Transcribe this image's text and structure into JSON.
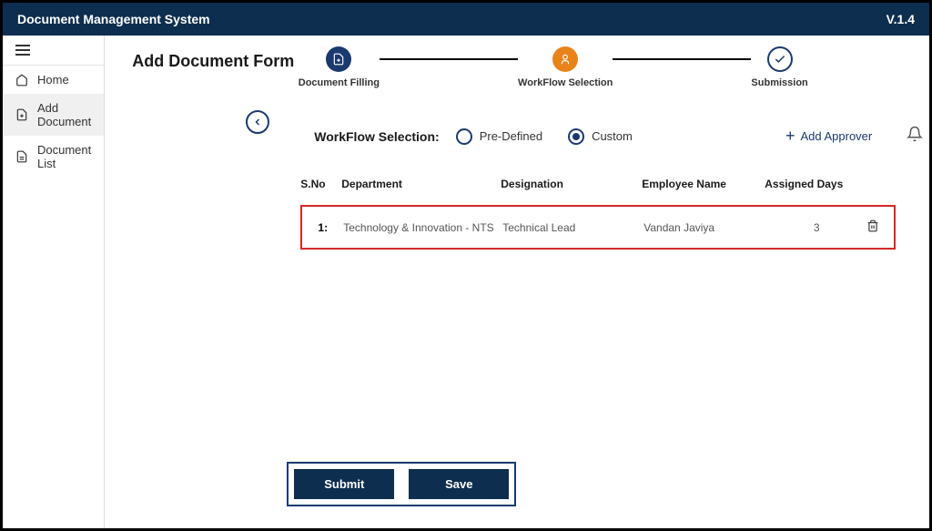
{
  "header": {
    "title": "Document Management System",
    "version": "V.1.4"
  },
  "sidebar": {
    "items": [
      {
        "label": "Home",
        "icon": "home-icon"
      },
      {
        "label": "Add Document",
        "icon": "add-doc-icon"
      },
      {
        "label": "Document List",
        "icon": "doc-list-icon"
      }
    ]
  },
  "page": {
    "title": "Add Document Form"
  },
  "stepper": {
    "steps": [
      {
        "label": "Document Filling"
      },
      {
        "label": "WorkFlow Selection"
      },
      {
        "label": "Submission"
      }
    ]
  },
  "workflow": {
    "label": "WorkFlow Selection:",
    "options": {
      "predefined": "Pre-Defined",
      "custom": "Custom"
    },
    "selected": "custom",
    "add_approver_label": "Add Approver"
  },
  "table": {
    "headers": {
      "sno": "S.No",
      "department": "Department",
      "designation": "Designation",
      "employee": "Employee Name",
      "days": "Assigned Days"
    },
    "rows": [
      {
        "sno": "1:",
        "department": "Technology & Innovation - NTS",
        "designation": "Technical Lead",
        "employee": "Vandan Javiya",
        "days": "3"
      }
    ]
  },
  "actions": {
    "submit": "Submit",
    "save": "Save"
  }
}
